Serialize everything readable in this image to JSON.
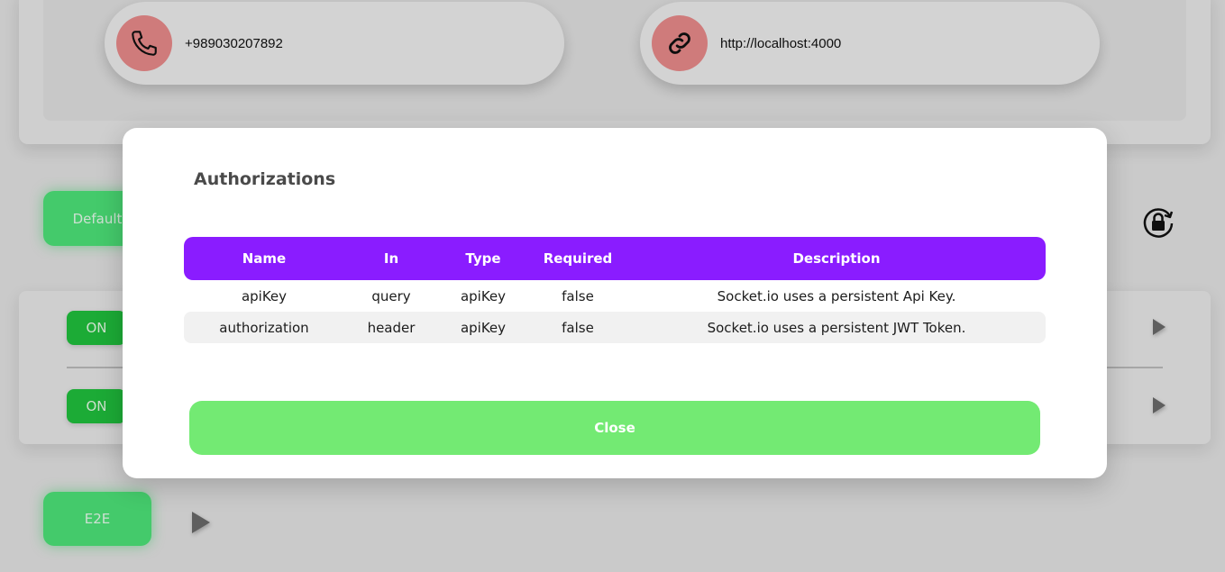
{
  "contact": {
    "phone": "+989030207892",
    "phone_icon": "phone-icon",
    "url": "http://localhost:4000",
    "url_icon": "link-icon"
  },
  "tabs": {
    "default_label": "Default",
    "e2e_label": "E2E"
  },
  "events": [
    {
      "status": "ON"
    },
    {
      "status": "ON"
    }
  ],
  "modal": {
    "title": "Authorizations",
    "columns": [
      "Name",
      "In",
      "Type",
      "Required",
      "Description"
    ],
    "rows": [
      [
        "apiKey",
        "query",
        "apiKey",
        "false",
        "Socket.io uses a persistent Api Key."
      ],
      [
        "authorization",
        "header",
        "apiKey",
        "false",
        "Socket.io uses a persistent JWT Token."
      ]
    ],
    "close_label": "Close"
  },
  "colors": {
    "accent_purple": "#8a1cff",
    "close_green": "#73ea73",
    "tab_green": "#4ee67a",
    "on_green": "#20c33e",
    "icon_circle": "#ec8c8c"
  }
}
